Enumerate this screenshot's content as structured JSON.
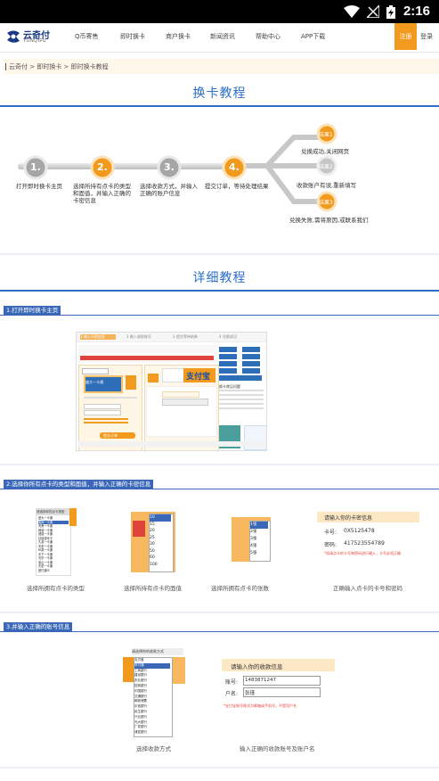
{
  "status_bar": {
    "time": "2:16"
  },
  "nav": {
    "logo_text": "云奇付",
    "logo_sub": "YUNQIFU",
    "items": [
      "Q币寄售",
      "即时换卡",
      "商户换卡",
      "新闻资讯",
      "帮助中心",
      "APP下载"
    ],
    "login": "注册",
    "register": "登录"
  },
  "breadcrumb": "云奇付 > 即时换卡 > 即时换卡教程",
  "section1": {
    "title": "换卡教程",
    "steps": [
      {
        "num": "1.",
        "label": "打开即时换卡主页"
      },
      {
        "num": "2.",
        "label": "选择所持有点卡的类型和面值，并输入正确的卡密信息"
      },
      {
        "num": "3.",
        "label": "选择收款方式，并输入正确的账户信息"
      },
      {
        "num": "4.",
        "label": "提交订单，等待处理结果"
      }
    ],
    "results": [
      {
        "badge": "结果1",
        "label": "兑换成功,关闭网页"
      },
      {
        "badge": "结果2",
        "label": "收款账户有误,重新填写"
      },
      {
        "badge": "结果3",
        "label": "兑换失败,需将原因,或联系我们"
      }
    ],
    "colors": {
      "accent": "#2b6fc7",
      "orange": "#f29a1e",
      "gray": "#b3b3b3"
    }
  },
  "section2": {
    "title": "详细教程",
    "tabs": [
      "1.打开即时换卡主页",
      "2.选择你所有点卡的类型和面值，并输入正确的卡密信息",
      "3.并输入正确的账号信息"
    ],
    "homepage_mock": {
      "progress": [
        "1 输入卡密信息",
        "2 输入收款账号",
        "3 提交等待结果",
        "4 兑换成功"
      ],
      "card_name": "盛大一卡通",
      "alipay": "支付宝",
      "submit": "提交订单",
      "side_title": "换卡常见问题"
    },
    "captions_row1": [
      "选择所拥有点卡的类型",
      "选择所持有点卡的面值",
      "选择所拥有点卡的张数",
      "正确输入点卡的卡号和密码"
    ],
    "card_types": [
      "盛大一卡通",
      "骏网一卡通",
      "完美一卡通",
      "网易一卡通",
      "搜狐一卡通",
      "征途游戏卡",
      "久游一卡通",
      "天宏一卡通",
      "纵游一卡通",
      "天下一卡通",
      "光宇一卡通",
      "金山一卡通",
      "天宏一卡通",
      "盛付通卡"
    ],
    "card_types_title": "请选择你的点卡类型",
    "denominations": [
      "10",
      "15",
      "20",
      "25",
      "30",
      "50",
      "60",
      "100"
    ],
    "quantities": [
      "1张",
      "2张",
      "3张",
      "4张",
      "5张"
    ],
    "card_info": {
      "title": "请输入你的卡密信息",
      "card_no_label": "卡号:",
      "card_no": "0X5125478",
      "pwd_label": "密码:",
      "pwd": "417523554789",
      "hint": "*如请点卡的卡号和密码进行输入，卡号必须正确"
    },
    "captions_row2": [
      "选择收款方式",
      "输入正确的收款账号及账户名"
    ],
    "payment_title": "请选择你的收款方式",
    "payment_methods": [
      "支付宝",
      "财付通",
      "工商银行",
      "建设银行",
      "农业银行",
      "招商银行",
      "中国银行",
      "交通银行",
      "邮政储蓄",
      "中信银行",
      "民生银行",
      "兴业银行",
      "光大银行",
      "广发银行",
      "浦发银行"
    ],
    "account_info": {
      "title": "请输入你的收款信息",
      "account_label": "账号:",
      "account": "1483871247",
      "name_label": "户名:",
      "name": "张瑾",
      "hint": "*支付宝账号格式为邮箱或手机号，不是用户名"
    }
  }
}
